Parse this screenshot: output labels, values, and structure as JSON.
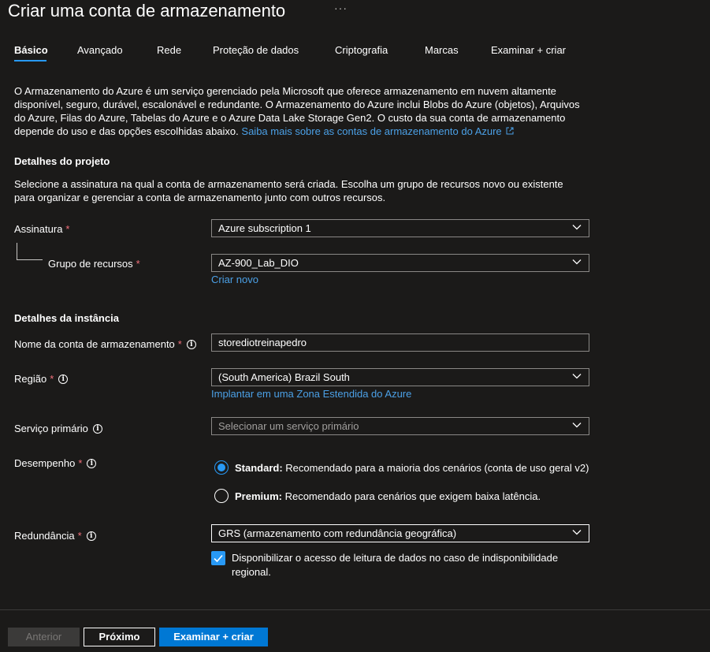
{
  "header": {
    "title": "Criar uma conta de armazenamento",
    "more": "···"
  },
  "tabs": [
    {
      "label": "Básico",
      "active": true
    },
    {
      "label": "Avançado"
    },
    {
      "label": "Rede"
    },
    {
      "label": "Proteção de dados"
    },
    {
      "label": "Criptografia"
    },
    {
      "label": "Marcas"
    },
    {
      "label": "Examinar + criar"
    }
  ],
  "intro": {
    "text": "O Armazenamento do Azure é um serviço gerenciado pela Microsoft que oferece armazenamento em nuvem altamente disponível, seguro, durável, escalonável e redundante. O Armazenamento do Azure inclui Blobs do Azure (objetos), Arquivos do Azure, Filas do Azure, Tabelas do Azure e o Azure Data Lake Storage Gen2. O custo da sua conta de armazenamento depende do uso e das opções escolhidas abaixo.",
    "link": "Saiba mais sobre as contas de armazenamento do Azure"
  },
  "project": {
    "heading": "Detalhes do projeto",
    "description": "Selecione a assinatura na qual a conta de armazenamento será criada. Escolha um grupo de recursos novo ou existente para organizar e gerenciar a conta de armazenamento junto com outros recursos.",
    "subscription_label": "Assinatura",
    "subscription_value": "Azure subscription 1",
    "resource_group_label": "Grupo de recursos",
    "resource_group_value": "AZ-900_Lab_DIO",
    "create_new": "Criar novo"
  },
  "instance": {
    "heading": "Detalhes da instância",
    "name_label": "Nome da conta de armazenamento",
    "name_value": "storediotreinapedro",
    "region_label": "Região",
    "region_value": "(South America) Brazil South",
    "edge_zone_link": "Implantar em uma Zona Estendida do Azure",
    "primary_service_label": "Serviço primário",
    "primary_service_placeholder": "Selecionar um serviço primário",
    "performance_label": "Desempenho",
    "performance_options": [
      {
        "name": "Standard:",
        "desc": " Recomendado para a maioria dos cenários (conta de uso geral v2)",
        "checked": true
      },
      {
        "name": "Premium:",
        "desc": " Recomendado para cenários que exigem baixa latência.",
        "checked": false
      }
    ],
    "redundancy_label": "Redundância",
    "redundancy_value": "GRS (armazenamento com redundância geográfica)",
    "read_access_label": "Disponibilizar o acesso de leitura de dados no caso de indisponibilidade regional.",
    "read_access_checked": true
  },
  "footer": {
    "previous": "Anterior",
    "next": "Próximo",
    "review": "Examinar + criar"
  },
  "required_mark": "*",
  "info_glyph": "i",
  "colors": {
    "background": "#1b1a19",
    "accent": "#2899f5",
    "link": "#4ba0e6",
    "primary_button": "#0078d4",
    "required": "#f1707b"
  }
}
